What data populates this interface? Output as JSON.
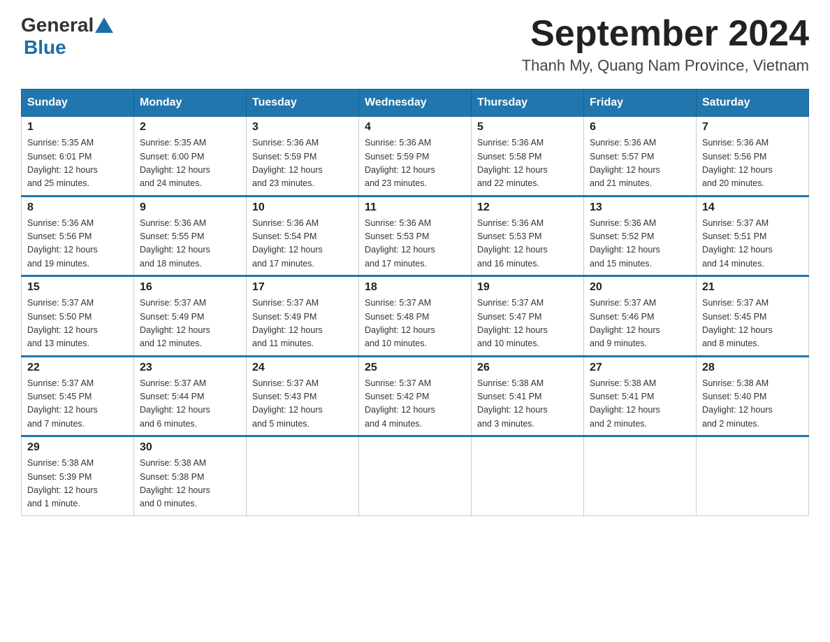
{
  "header": {
    "logo_general": "General",
    "logo_blue": "Blue",
    "month_title": "September 2024",
    "location": "Thanh My, Quang Nam Province, Vietnam"
  },
  "days_of_week": [
    "Sunday",
    "Monday",
    "Tuesday",
    "Wednesday",
    "Thursday",
    "Friday",
    "Saturday"
  ],
  "weeks": [
    [
      {
        "num": "1",
        "sunrise": "5:35 AM",
        "sunset": "6:01 PM",
        "daylight": "12 hours and 25 minutes."
      },
      {
        "num": "2",
        "sunrise": "5:35 AM",
        "sunset": "6:00 PM",
        "daylight": "12 hours and 24 minutes."
      },
      {
        "num": "3",
        "sunrise": "5:36 AM",
        "sunset": "5:59 PM",
        "daylight": "12 hours and 23 minutes."
      },
      {
        "num": "4",
        "sunrise": "5:36 AM",
        "sunset": "5:59 PM",
        "daylight": "12 hours and 23 minutes."
      },
      {
        "num": "5",
        "sunrise": "5:36 AM",
        "sunset": "5:58 PM",
        "daylight": "12 hours and 22 minutes."
      },
      {
        "num": "6",
        "sunrise": "5:36 AM",
        "sunset": "5:57 PM",
        "daylight": "12 hours and 21 minutes."
      },
      {
        "num": "7",
        "sunrise": "5:36 AM",
        "sunset": "5:56 PM",
        "daylight": "12 hours and 20 minutes."
      }
    ],
    [
      {
        "num": "8",
        "sunrise": "5:36 AM",
        "sunset": "5:56 PM",
        "daylight": "12 hours and 19 minutes."
      },
      {
        "num": "9",
        "sunrise": "5:36 AM",
        "sunset": "5:55 PM",
        "daylight": "12 hours and 18 minutes."
      },
      {
        "num": "10",
        "sunrise": "5:36 AM",
        "sunset": "5:54 PM",
        "daylight": "12 hours and 17 minutes."
      },
      {
        "num": "11",
        "sunrise": "5:36 AM",
        "sunset": "5:53 PM",
        "daylight": "12 hours and 17 minutes."
      },
      {
        "num": "12",
        "sunrise": "5:36 AM",
        "sunset": "5:53 PM",
        "daylight": "12 hours and 16 minutes."
      },
      {
        "num": "13",
        "sunrise": "5:36 AM",
        "sunset": "5:52 PM",
        "daylight": "12 hours and 15 minutes."
      },
      {
        "num": "14",
        "sunrise": "5:37 AM",
        "sunset": "5:51 PM",
        "daylight": "12 hours and 14 minutes."
      }
    ],
    [
      {
        "num": "15",
        "sunrise": "5:37 AM",
        "sunset": "5:50 PM",
        "daylight": "12 hours and 13 minutes."
      },
      {
        "num": "16",
        "sunrise": "5:37 AM",
        "sunset": "5:49 PM",
        "daylight": "12 hours and 12 minutes."
      },
      {
        "num": "17",
        "sunrise": "5:37 AM",
        "sunset": "5:49 PM",
        "daylight": "12 hours and 11 minutes."
      },
      {
        "num": "18",
        "sunrise": "5:37 AM",
        "sunset": "5:48 PM",
        "daylight": "12 hours and 10 minutes."
      },
      {
        "num": "19",
        "sunrise": "5:37 AM",
        "sunset": "5:47 PM",
        "daylight": "12 hours and 10 minutes."
      },
      {
        "num": "20",
        "sunrise": "5:37 AM",
        "sunset": "5:46 PM",
        "daylight": "12 hours and 9 minutes."
      },
      {
        "num": "21",
        "sunrise": "5:37 AM",
        "sunset": "5:45 PM",
        "daylight": "12 hours and 8 minutes."
      }
    ],
    [
      {
        "num": "22",
        "sunrise": "5:37 AM",
        "sunset": "5:45 PM",
        "daylight": "12 hours and 7 minutes."
      },
      {
        "num": "23",
        "sunrise": "5:37 AM",
        "sunset": "5:44 PM",
        "daylight": "12 hours and 6 minutes."
      },
      {
        "num": "24",
        "sunrise": "5:37 AM",
        "sunset": "5:43 PM",
        "daylight": "12 hours and 5 minutes."
      },
      {
        "num": "25",
        "sunrise": "5:37 AM",
        "sunset": "5:42 PM",
        "daylight": "12 hours and 4 minutes."
      },
      {
        "num": "26",
        "sunrise": "5:38 AM",
        "sunset": "5:41 PM",
        "daylight": "12 hours and 3 minutes."
      },
      {
        "num": "27",
        "sunrise": "5:38 AM",
        "sunset": "5:41 PM",
        "daylight": "12 hours and 2 minutes."
      },
      {
        "num": "28",
        "sunrise": "5:38 AM",
        "sunset": "5:40 PM",
        "daylight": "12 hours and 2 minutes."
      }
    ],
    [
      {
        "num": "29",
        "sunrise": "5:38 AM",
        "sunset": "5:39 PM",
        "daylight": "12 hours and 1 minute."
      },
      {
        "num": "30",
        "sunrise": "5:38 AM",
        "sunset": "5:38 PM",
        "daylight": "12 hours and 0 minutes."
      },
      null,
      null,
      null,
      null,
      null
    ]
  ]
}
